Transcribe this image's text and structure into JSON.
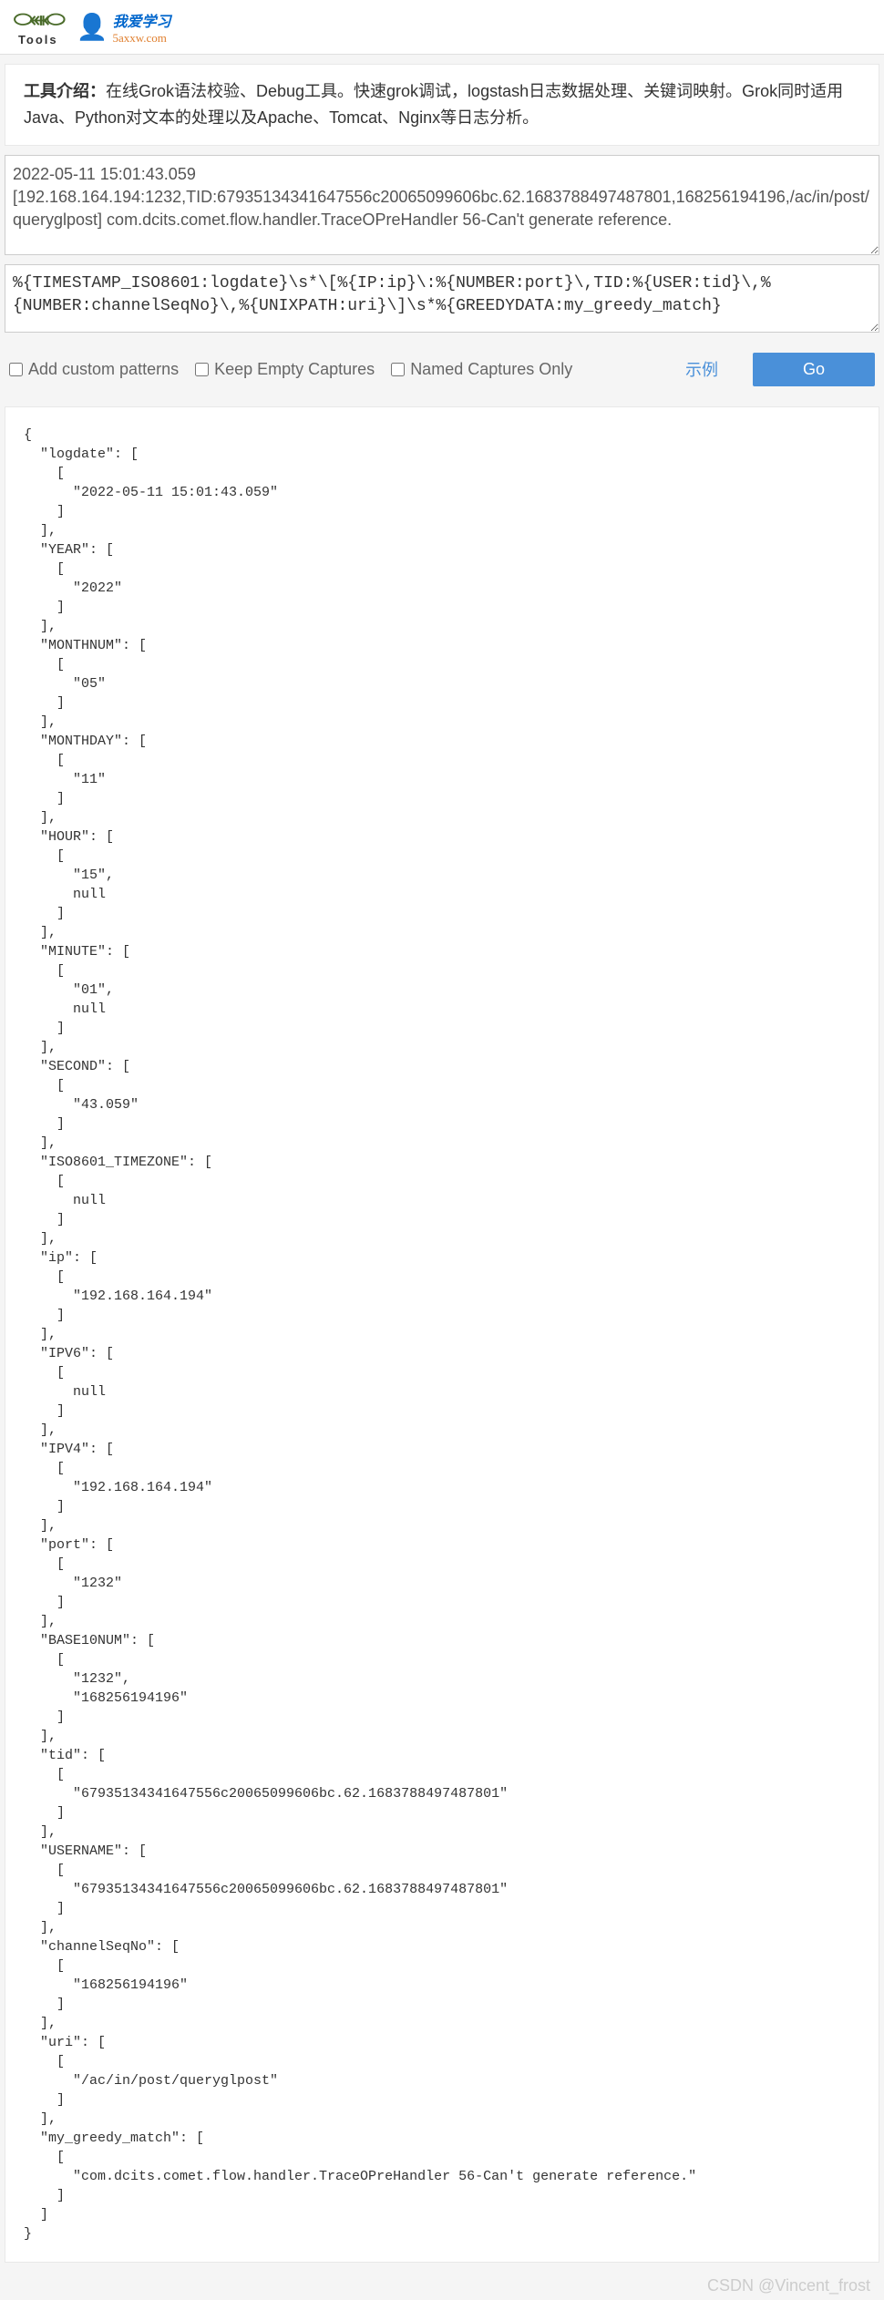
{
  "header": {
    "logo1_text": "Tools",
    "logo2_cn": "我爱学习",
    "logo2_url": "5axxw.com"
  },
  "intro": {
    "label": "工具介绍：",
    "text": "在线Grok语法校验、Debug工具。快速grok调试，logstash日志数据处理、关键词映射。Grok同时适用Java、Python对文本的处理以及Apache、Tomcat、Nginx等日志分析。"
  },
  "inputs": {
    "log_text": "2022-05-11 15:01:43.059 [192.168.164.194:1232,TID:67935134341647556c20065099606bc.62.1683788497487801,168256194196,/ac/in/post/queryglpost] com.dcits.comet.flow.handler.TraceOPreHandler 56-Can't generate reference.",
    "pattern_text": "%{TIMESTAMP_ISO8601:logdate}\\s*\\[%{IP:ip}\\:%{NUMBER:port}\\,TID:%{USER:tid}\\,%{NUMBER:channelSeqNo}\\,%{UNIXPATH:uri}\\]\\s*%{GREEDYDATA:my_greedy_match}"
  },
  "controls": {
    "add_patterns": "Add custom patterns",
    "keep_empty": "Keep Empty Captures",
    "named_only": "Named Captures Only",
    "example": "示例",
    "go": "Go"
  },
  "result": "{\n  \"logdate\": [\n    [\n      \"2022-05-11 15:01:43.059\"\n    ]\n  ],\n  \"YEAR\": [\n    [\n      \"2022\"\n    ]\n  ],\n  \"MONTHNUM\": [\n    [\n      \"05\"\n    ]\n  ],\n  \"MONTHDAY\": [\n    [\n      \"11\"\n    ]\n  ],\n  \"HOUR\": [\n    [\n      \"15\",\n      null\n    ]\n  ],\n  \"MINUTE\": [\n    [\n      \"01\",\n      null\n    ]\n  ],\n  \"SECOND\": [\n    [\n      \"43.059\"\n    ]\n  ],\n  \"ISO8601_TIMEZONE\": [\n    [\n      null\n    ]\n  ],\n  \"ip\": [\n    [\n      \"192.168.164.194\"\n    ]\n  ],\n  \"IPV6\": [\n    [\n      null\n    ]\n  ],\n  \"IPV4\": [\n    [\n      \"192.168.164.194\"\n    ]\n  ],\n  \"port\": [\n    [\n      \"1232\"\n    ]\n  ],\n  \"BASE10NUM\": [\n    [\n      \"1232\",\n      \"168256194196\"\n    ]\n  ],\n  \"tid\": [\n    [\n      \"67935134341647556c20065099606bc.62.1683788497487801\"\n    ]\n  ],\n  \"USERNAME\": [\n    [\n      \"67935134341647556c20065099606bc.62.1683788497487801\"\n    ]\n  ],\n  \"channelSeqNo\": [\n    [\n      \"168256194196\"\n    ]\n  ],\n  \"uri\": [\n    [\n      \"/ac/in/post/queryglpost\"\n    ]\n  ],\n  \"my_greedy_match\": [\n    [\n      \"com.dcits.comet.flow.handler.TraceOPreHandler 56-Can't generate reference.\"\n    ]\n  ]\n}",
  "watermark": "CSDN @Vincent_frost"
}
